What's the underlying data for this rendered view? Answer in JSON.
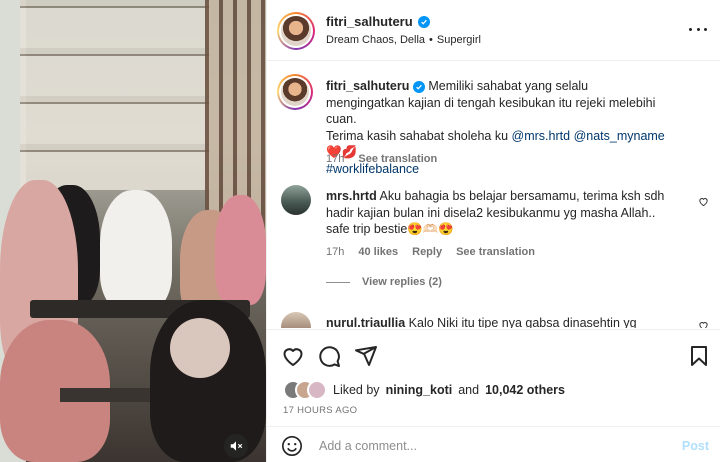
{
  "post": {
    "username": "fitri_salhuteru",
    "audio_song": "Dream Chaos, Della",
    "audio_sep": "•",
    "audio_artist": "Supergirl"
  },
  "caption": {
    "username": "fitri_salhuteru",
    "line1": "Memiliki sahabat yang selalu mengingatkan kajian di tengah kesibukan itu rejeki melebihi cuan.",
    "line2_prefix": "Terima kasih sahabat sholeha ku",
    "mention1": "@mrs.hrtd",
    "mention2": "@nats_myname",
    "emojis": "❤️💋",
    "hashtag": "#worklifebalance",
    "time": "17h",
    "see_translation": "See translation"
  },
  "comment1": {
    "username": "mrs.hrtd",
    "text": "Aku bahagia bs belajar bersamamu, terima ksh sdh hadir kajian bulan ini disela2 kesibukanmu yg masha Allah.. safe trip bestie😍🫶🏻😍",
    "time": "17h",
    "likes": "40 likes",
    "reply": "Reply",
    "see_translation": "See translation",
    "view_replies": "View replies (2)"
  },
  "comment2": {
    "username": "nurul.triaullia",
    "text": "Kalo Niki itu tipe nya gabsa dinasehtin yg"
  },
  "likes": {
    "prefix": "Liked by",
    "user": "nining_koti",
    "and": "and",
    "count": "10,042 others"
  },
  "timestamp": "17 HOURS AGO",
  "add_comment": {
    "placeholder": "Add a comment...",
    "post": "Post"
  },
  "colors": {
    "verified": "#0095f6",
    "link": "#00376b",
    "muted": "#737373",
    "post_disabled": "#b2dffc"
  },
  "icons": [
    "verified-icon",
    "more-options-icon",
    "heart-icon",
    "comment-icon",
    "share-icon",
    "bookmark-icon",
    "emoji-icon",
    "mute-icon"
  ]
}
